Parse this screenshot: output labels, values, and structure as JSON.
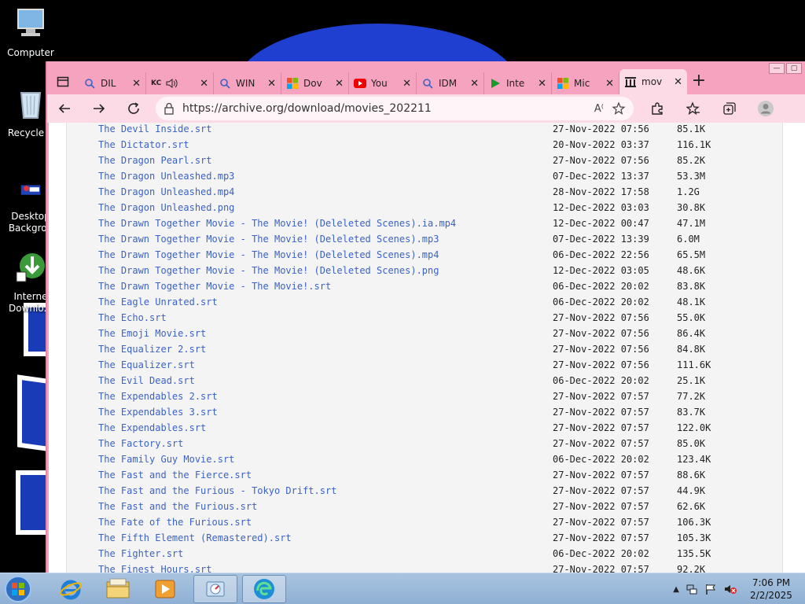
{
  "desktop": {
    "icons": [
      {
        "label": "Computer",
        "icon": "computer-icon"
      },
      {
        "label": "Recycle B",
        "icon": "recycle-bin-icon"
      },
      {
        "label": "Desktop Backgrou",
        "icon": "desktop-background-icon"
      },
      {
        "label": "Interne Downlo...",
        "icon": "idm-icon"
      }
    ]
  },
  "browser": {
    "tabs": [
      {
        "label": "DIL",
        "icon": "search-icon",
        "active": false
      },
      {
        "label": "",
        "icon": "audio-icon",
        "active": false
      },
      {
        "label": "WIN",
        "icon": "search-icon",
        "active": false
      },
      {
        "label": "Dov",
        "icon": "microsoft-icon",
        "active": false
      },
      {
        "label": "You",
        "icon": "youtube-icon",
        "active": false
      },
      {
        "label": "IDM",
        "icon": "search-icon",
        "active": false
      },
      {
        "label": "Inte",
        "icon": "play-icon",
        "active": false
      },
      {
        "label": "Mic",
        "icon": "microsoft-icon",
        "active": false
      },
      {
        "label": "mov",
        "icon": "archive-icon",
        "active": true
      }
    ],
    "address": {
      "url": "https://archive.org/download/movies_202211"
    },
    "colors": {
      "frame": "#f5a3bf",
      "toolbar": "#fcdbe6",
      "link": "#3b62c4"
    }
  },
  "files": [
    {
      "name": "The Devil Inside.srt",
      "date": "27-Nov-2022 07:56",
      "size": "85.1K"
    },
    {
      "name": "The Dictator.srt",
      "date": "20-Nov-2022 03:37",
      "size": "116.1K"
    },
    {
      "name": "The Dragon Pearl.srt",
      "date": "27-Nov-2022 07:56",
      "size": "85.2K"
    },
    {
      "name": "The Dragon Unleashed.mp3",
      "date": "07-Dec-2022 13:37",
      "size": "53.3M"
    },
    {
      "name": "The Dragon Unleashed.mp4",
      "date": "28-Nov-2022 17:58",
      "size": "1.2G"
    },
    {
      "name": "The Dragon Unleashed.png",
      "date": "12-Dec-2022 03:03",
      "size": "30.8K"
    },
    {
      "name": "The Drawn Together Movie - The Movie! (Deleleted Scenes).ia.mp4",
      "date": "12-Dec-2022 00:47",
      "size": "47.1M"
    },
    {
      "name": "The Drawn Together Movie - The Movie! (Deleleted Scenes).mp3",
      "date": "07-Dec-2022 13:39",
      "size": "6.0M"
    },
    {
      "name": "The Drawn Together Movie - The Movie! (Deleleted Scenes).mp4",
      "date": "06-Dec-2022 22:56",
      "size": "65.5M"
    },
    {
      "name": "The Drawn Together Movie - The Movie! (Deleleted Scenes).png",
      "date": "12-Dec-2022 03:05",
      "size": "48.6K"
    },
    {
      "name": "The Drawn Together Movie - The Movie!.srt",
      "date": "06-Dec-2022 20:02",
      "size": "83.8K"
    },
    {
      "name": "The Eagle Unrated.srt",
      "date": "06-Dec-2022 20:02",
      "size": "48.1K"
    },
    {
      "name": "The Echo.srt",
      "date": "27-Nov-2022 07:56",
      "size": "55.0K"
    },
    {
      "name": "The Emoji Movie.srt",
      "date": "27-Nov-2022 07:56",
      "size": "86.4K"
    },
    {
      "name": "The Equalizer 2.srt",
      "date": "27-Nov-2022 07:56",
      "size": "84.8K"
    },
    {
      "name": "The Equalizer.srt",
      "date": "27-Nov-2022 07:56",
      "size": "111.6K"
    },
    {
      "name": "The Evil Dead.srt",
      "date": "06-Dec-2022 20:02",
      "size": "25.1K"
    },
    {
      "name": "The Expendables 2.srt",
      "date": "27-Nov-2022 07:57",
      "size": "77.2K"
    },
    {
      "name": "The Expendables 3.srt",
      "date": "27-Nov-2022 07:57",
      "size": "83.7K"
    },
    {
      "name": "The Expendables.srt",
      "date": "27-Nov-2022 07:57",
      "size": "122.0K"
    },
    {
      "name": "The Factory.srt",
      "date": "27-Nov-2022 07:57",
      "size": "85.0K"
    },
    {
      "name": "The Family Guy Movie.srt",
      "date": "06-Dec-2022 20:02",
      "size": "123.4K"
    },
    {
      "name": "The Fast and the Fierce.srt",
      "date": "27-Nov-2022 07:57",
      "size": "88.6K"
    },
    {
      "name": "The Fast and the Furious - Tokyo Drift.srt",
      "date": "27-Nov-2022 07:57",
      "size": "44.9K"
    },
    {
      "name": "The Fast and the Furious.srt",
      "date": "27-Nov-2022 07:57",
      "size": "62.6K"
    },
    {
      "name": "The Fate of the Furious.srt",
      "date": "27-Nov-2022 07:57",
      "size": "106.3K"
    },
    {
      "name": "The Fifth Element (Remastered).srt",
      "date": "27-Nov-2022 07:57",
      "size": "105.3K"
    },
    {
      "name": "The Fighter.srt",
      "date": "06-Dec-2022 20:02",
      "size": "135.5K"
    },
    {
      "name": "The Finest Hours.srt",
      "date": "27-Nov-2022 07:57",
      "size": "92.2K"
    }
  ],
  "taskbar": {
    "items": [
      "start-orb-icon",
      "internet-explorer-icon",
      "file-explorer-icon",
      "media-player-icon",
      "control-panel-icon",
      "edge-icon"
    ],
    "clock": {
      "time": "7:06 PM",
      "date": "2/2/2025"
    }
  }
}
